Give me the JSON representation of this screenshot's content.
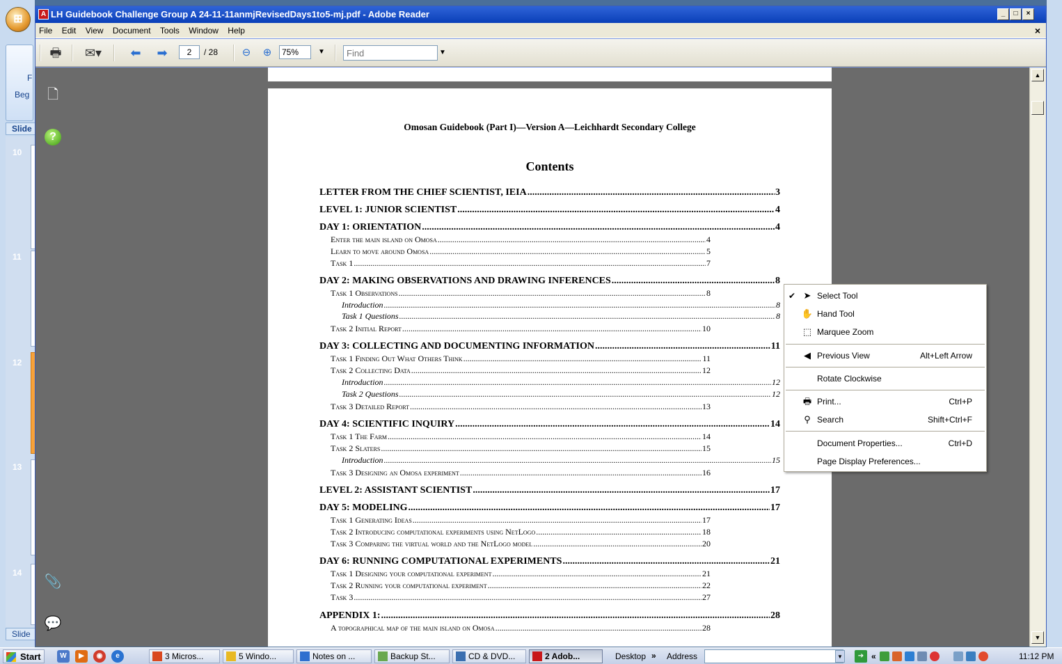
{
  "window": {
    "title": "LH Guidebook Challenge Group A 24-11-11anmjRevisedDays1to5-mj.pdf - Adobe Reader",
    "menu": [
      "File",
      "Edit",
      "View",
      "Document",
      "Tools",
      "Window",
      "Help"
    ]
  },
  "background_app": {
    "ribbon_text_top": "F",
    "ribbon_text_bottom": "Beg",
    "slides_tab": "Slide",
    "slide_tab_bottom": "Slide",
    "slide_numbers": [
      "10",
      "11",
      "12",
      "13",
      "14"
    ],
    "selected_slide": "12"
  },
  "toolbar": {
    "page_current": "2",
    "page_total": "/ 28",
    "zoom": "75%",
    "find_placeholder": "Find"
  },
  "document": {
    "header": "Omosan Guidebook (Part I)—Version A—Leichhardt Secondary College",
    "heading": "Contents",
    "toc": [
      {
        "level": 0,
        "text": "LETTER FROM THE CHIEF SCIENTIST, IEIA",
        "page": "3"
      },
      {
        "level": 0,
        "text": "LEVEL 1:  JUNIOR SCIENTIST",
        "page": "4"
      },
      {
        "level": 0,
        "text": "DAY 1:  ORIENTATION",
        "page": "4"
      },
      {
        "level": 1,
        "text": "Enter the main island on Omosa",
        "page": "4"
      },
      {
        "level": 1,
        "text": "Learn to move around Omosa",
        "page": "5"
      },
      {
        "level": 1,
        "text": "Task 1",
        "page": "7"
      },
      {
        "level": 0,
        "text": "DAY 2: MAKING OBSERVATIONS AND DRAWING INFERENCES",
        "page": "8"
      },
      {
        "level": 1,
        "text": "Task 1 Observations",
        "page": "8"
      },
      {
        "level": 2,
        "text": "Introduction",
        "page": "8"
      },
      {
        "level": 2,
        "text": "Task 1 Questions",
        "page": "8"
      },
      {
        "level": 1,
        "text": "Task 2 Initial Report",
        "page": "10"
      },
      {
        "level": 0,
        "text": "DAY 3: COLLECTING AND DOCUMENTING INFORMATION",
        "page": "11"
      },
      {
        "level": 1,
        "text": "Task 1 Finding Out What Others Think",
        "page": "11"
      },
      {
        "level": 1,
        "text": "Task 2 Collecting Data",
        "page": "12"
      },
      {
        "level": 2,
        "text": "Introduction",
        "page": "12"
      },
      {
        "level": 2,
        "text": "Task 2 Questions",
        "page": "12"
      },
      {
        "level": 1,
        "text": "Task 3 Detailed Report",
        "page": "13"
      },
      {
        "level": 0,
        "text": "DAY 4: SCIENTIFIC INQUIRY",
        "page": "14"
      },
      {
        "level": 1,
        "text": "Task 1 The Farm",
        "page": "14"
      },
      {
        "level": 1,
        "text": "Task 2  Slaters",
        "page": "15"
      },
      {
        "level": 2,
        "text": "Introduction",
        "page": "15"
      },
      {
        "level": 1,
        "text": "Task 3  Designing an Omosa experiment",
        "page": "16"
      },
      {
        "level": 0,
        "text": "LEVEL 2: ASSISTANT SCIENTIST",
        "page": "17"
      },
      {
        "level": 0,
        "text": "DAY 5: MODELING",
        "page": "17"
      },
      {
        "level": 1,
        "text": "Task 1  Generating Ideas",
        "page": "17"
      },
      {
        "level": 1,
        "text": "Task 2 Introducing computational experiments using NetLogo",
        "page": "18"
      },
      {
        "level": 1,
        "text": "Task 3 Comparing the virtual world and the NetLogo model",
        "page": "20"
      },
      {
        "level": 0,
        "text": "DAY 6: RUNNING COMPUTATIONAL EXPERIMENTS",
        "page": "21"
      },
      {
        "level": 1,
        "text": "Task 1   Designing your computational experiment",
        "page": "21"
      },
      {
        "level": 1,
        "text": "Task 2 Running your computational experiment",
        "page": "22"
      },
      {
        "level": 1,
        "text": "Task 3",
        "page": "27"
      },
      {
        "level": 0,
        "text": "APPENDIX 1:",
        "page": "28"
      },
      {
        "level": 1,
        "text": "A topographical map of the main island on Omosa",
        "page": "28"
      }
    ]
  },
  "context_menu": {
    "items": [
      {
        "label": "Select Tool",
        "shortcut": "",
        "checked": true,
        "icon": "arrow-cursor-icon",
        "glyph": "➤"
      },
      {
        "label": "Hand Tool",
        "shortcut": "",
        "checked": false,
        "icon": "hand-icon",
        "glyph": "✋"
      },
      {
        "label": "Marquee Zoom",
        "shortcut": "",
        "checked": false,
        "icon": "marquee-zoom-icon",
        "glyph": "⬚"
      },
      {
        "label": "Previous View",
        "shortcut": "Alt+Left Arrow",
        "checked": false,
        "icon": "previous-view-icon",
        "glyph": "◀"
      },
      {
        "label": "Rotate Clockwise",
        "shortcut": "",
        "checked": false,
        "icon": "",
        "glyph": ""
      },
      {
        "label": "Print...",
        "shortcut": "Ctrl+P",
        "checked": false,
        "icon": "printer-icon",
        "glyph": "🖶"
      },
      {
        "label": "Search",
        "shortcut": "Shift+Ctrl+F",
        "checked": false,
        "icon": "binoculars-icon",
        "glyph": "⚲"
      },
      {
        "label": "Document Properties...",
        "shortcut": "Ctrl+D",
        "checked": false,
        "icon": "",
        "glyph": ""
      },
      {
        "label": "Page Display Preferences...",
        "shortcut": "",
        "checked": false,
        "icon": "",
        "glyph": ""
      }
    ]
  },
  "taskbar": {
    "start": "Start",
    "tasks": [
      {
        "label": "3 Micros...",
        "active": false,
        "color": "#d9481f"
      },
      {
        "label": "5 Windo...",
        "active": false,
        "color": "#e8b923"
      },
      {
        "label": "Notes on ...",
        "active": false,
        "color": "#2f6fcf"
      },
      {
        "label": "Backup St...",
        "active": false,
        "color": "#6aa84f"
      },
      {
        "label": "CD & DVD...",
        "active": false,
        "color": "#3b6fb0"
      },
      {
        "label": "2 Adob...",
        "active": true,
        "color": "#c8181a"
      }
    ],
    "desktop": "Desktop",
    "address_label": "Address",
    "clock": "11:12 PM"
  },
  "colors": {
    "titlebar": "#0a3fb8",
    "pdf_background": "#6b6b6b",
    "selected_slide": "#f7a23a"
  }
}
